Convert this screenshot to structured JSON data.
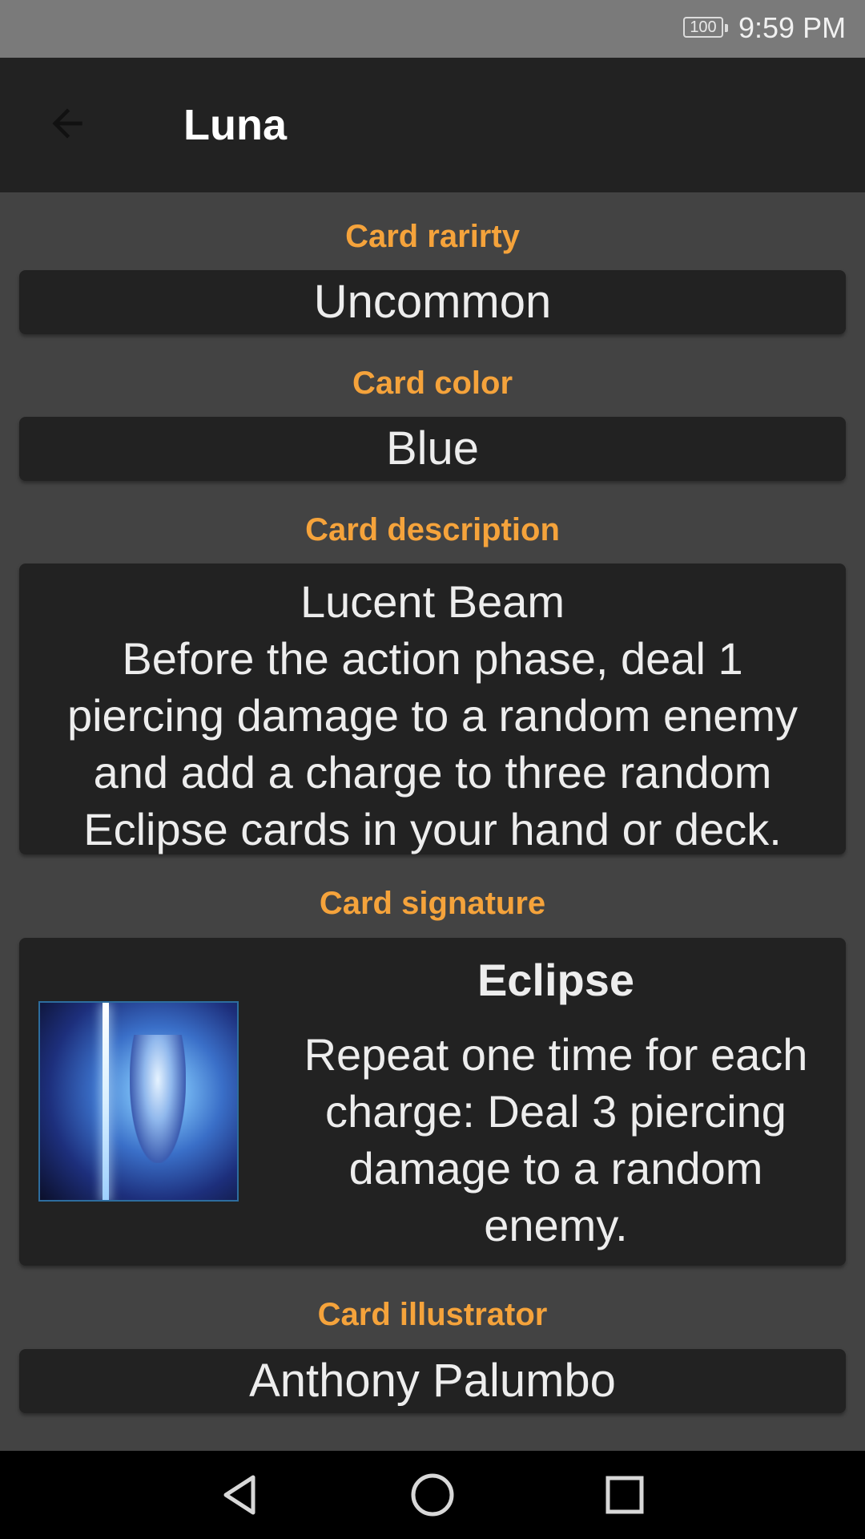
{
  "status_bar": {
    "battery": "100",
    "time": "9:59 PM"
  },
  "app_bar": {
    "back_icon": "arrow-left-icon",
    "title": "Luna"
  },
  "sections": {
    "rarity": {
      "label": "Card rarirty",
      "value": "Uncommon"
    },
    "color": {
      "label": "Card color",
      "value": "Blue"
    },
    "description": {
      "label": "Card description",
      "lines": [
        "Lucent Beam",
        "Before the action phase, deal 1",
        "piercing damage to a random enemy",
        "and add a charge to three random",
        "Eclipse cards in your hand or deck."
      ]
    },
    "signature": {
      "label": "Card signature",
      "title": "Eclipse",
      "text": "Repeat one time for each charge: Deal 3 piercing damage to a random enemy."
    },
    "illustrator": {
      "label": "Card illustrator",
      "value": "Anthony Palumbo"
    }
  },
  "nav_bar": {
    "back": "triangle-back-icon",
    "home": "circle-home-icon",
    "recents": "square-recents-icon"
  },
  "colors": {
    "accent": "#f5a33b",
    "background": "#434343",
    "card": "#222222",
    "app_bar": "#222222",
    "status_bar": "#7a7a7a"
  }
}
